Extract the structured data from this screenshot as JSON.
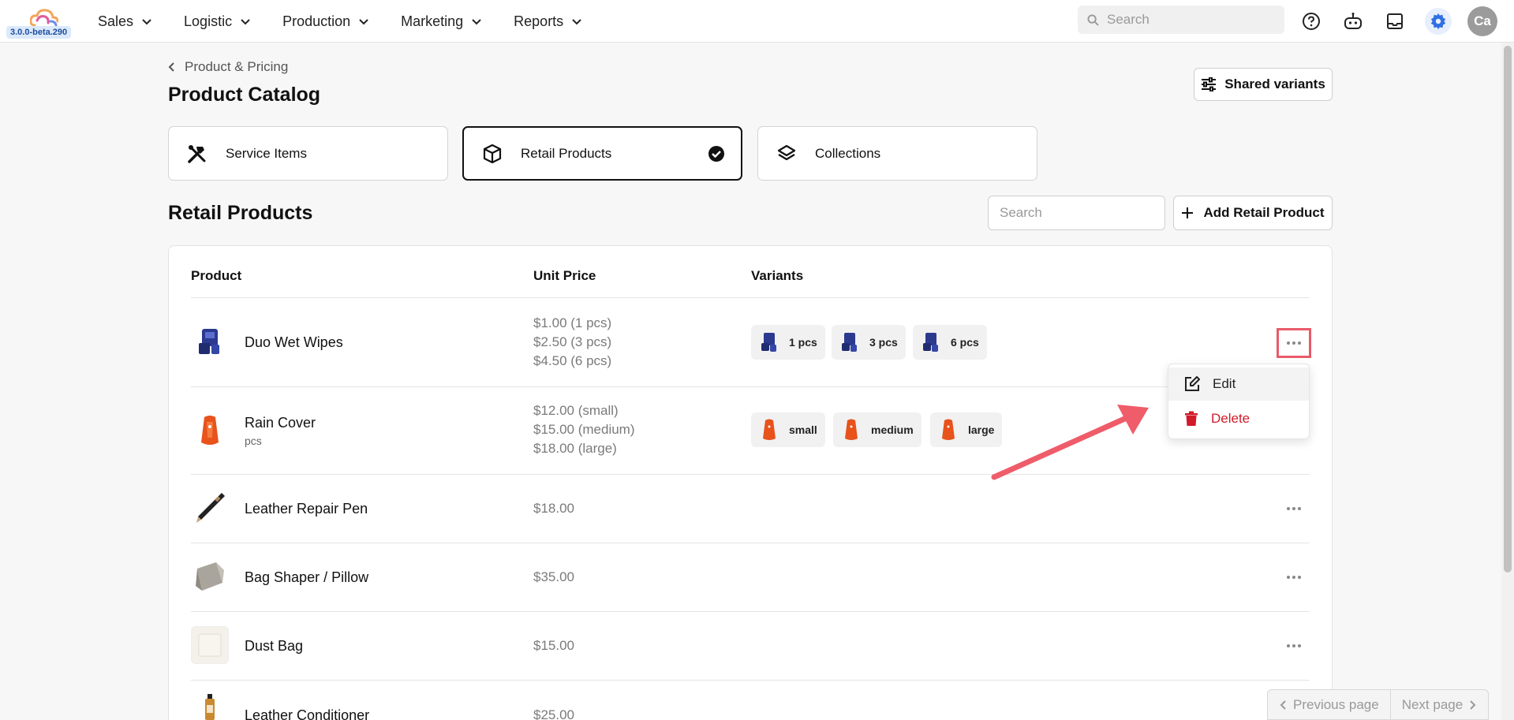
{
  "app": {
    "version": "3.0.0-beta.290",
    "brand_colors": [
      "#f2a65a",
      "#e05b9a",
      "#6b8fe8"
    ]
  },
  "nav": {
    "items": [
      {
        "label": "Sales"
      },
      {
        "label": "Logistic"
      },
      {
        "label": "Production"
      },
      {
        "label": "Marketing"
      },
      {
        "label": "Reports"
      }
    ]
  },
  "topbar": {
    "search_placeholder": "Search",
    "icons": [
      "help-icon",
      "bot-icon",
      "inbox-icon",
      "settings-icon"
    ],
    "avatar_initials": "Ca"
  },
  "header": {
    "breadcrumb": "Product & Pricing",
    "title": "Product Catalog",
    "shared_variants_label": "Shared variants"
  },
  "types": [
    {
      "label": "Service Items",
      "icon": "tools-icon",
      "active": false
    },
    {
      "label": "Retail Products",
      "icon": "box-icon",
      "active": true
    },
    {
      "label": "Collections",
      "icon": "layers-icon",
      "active": false
    }
  ],
  "list": {
    "title": "Retail Products",
    "search_placeholder": "Search",
    "add_label": "Add Retail Product",
    "columns": [
      "Product",
      "Unit Price",
      "Variants"
    ]
  },
  "rows": [
    {
      "name": "Duo Wet Wipes",
      "unit": "",
      "prices": [
        "$1.00 (1 pcs)",
        "$2.50 (3 pcs)",
        "$4.50 (6 pcs)"
      ],
      "variants": [
        "1 pcs",
        "3 pcs",
        "6 pcs"
      ]
    },
    {
      "name": "Rain Cover",
      "unit": "pcs",
      "prices": [
        "$12.00 (small)",
        "$15.00 (medium)",
        "$18.00 (large)"
      ],
      "variants": [
        "small",
        "medium",
        "large"
      ]
    },
    {
      "name": "Leather Repair Pen",
      "unit": "",
      "prices": [
        "$18.00"
      ],
      "variants": []
    },
    {
      "name": "Bag Shaper / Pillow",
      "unit": "",
      "prices": [
        "$35.00"
      ],
      "variants": []
    },
    {
      "name": "Dust Bag",
      "unit": "",
      "prices": [
        "$15.00"
      ],
      "variants": []
    },
    {
      "name": "Leather Conditioner",
      "unit": "",
      "prices": [
        "$25.00"
      ],
      "variants": []
    }
  ],
  "row_menu": {
    "edit_label": "Edit",
    "delete_label": "Delete"
  },
  "pager": {
    "prev_label": "Previous page",
    "next_label": "Next page"
  },
  "colors": {
    "accent_blue": "#2f6fe4",
    "danger": "#d11a2a",
    "highlight": "#e95a6a"
  }
}
